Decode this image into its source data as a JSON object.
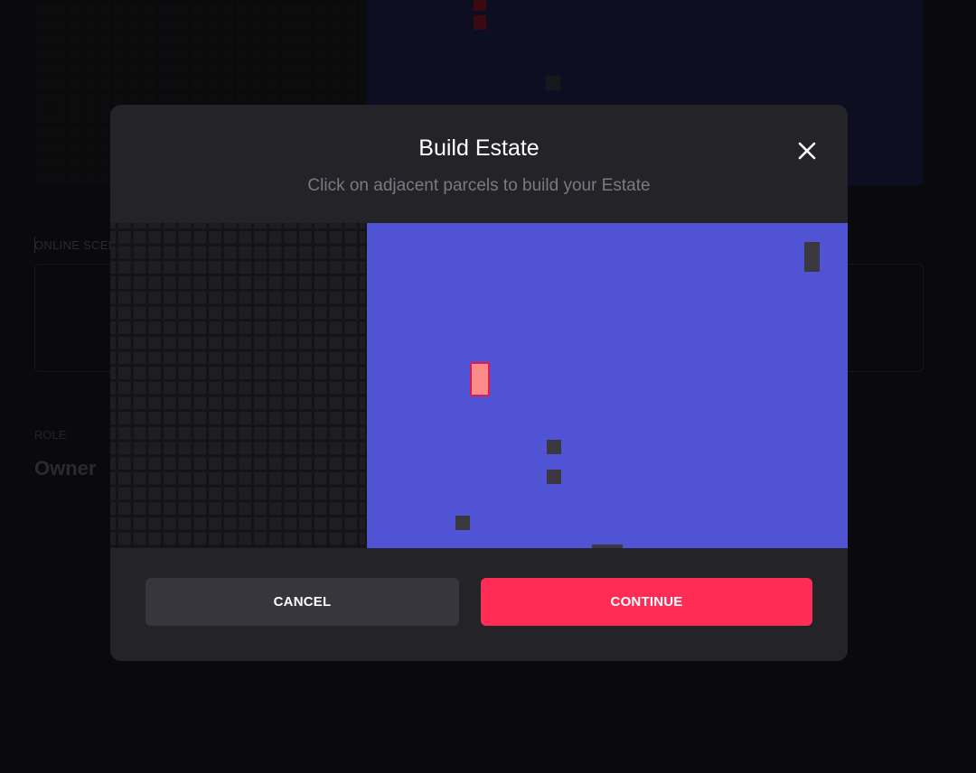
{
  "background": {
    "section_label": "ONLINE SCENES",
    "role_label": "ROLE",
    "role_value": "Owner"
  },
  "modal": {
    "title": "Build Estate",
    "subtitle": "Click on adjacent parcels to build your Estate",
    "close_icon": "close-icon",
    "cancel_label": "CANCEL",
    "continue_label": "CONTINUE"
  },
  "colors": {
    "map_blue": "#5053d3",
    "selected_parcel": "#fb8c8a",
    "selected_border": "#e9184a",
    "continue_button": "#ff2d55",
    "cancel_button": "#37363c",
    "modal_background": "#242328"
  }
}
